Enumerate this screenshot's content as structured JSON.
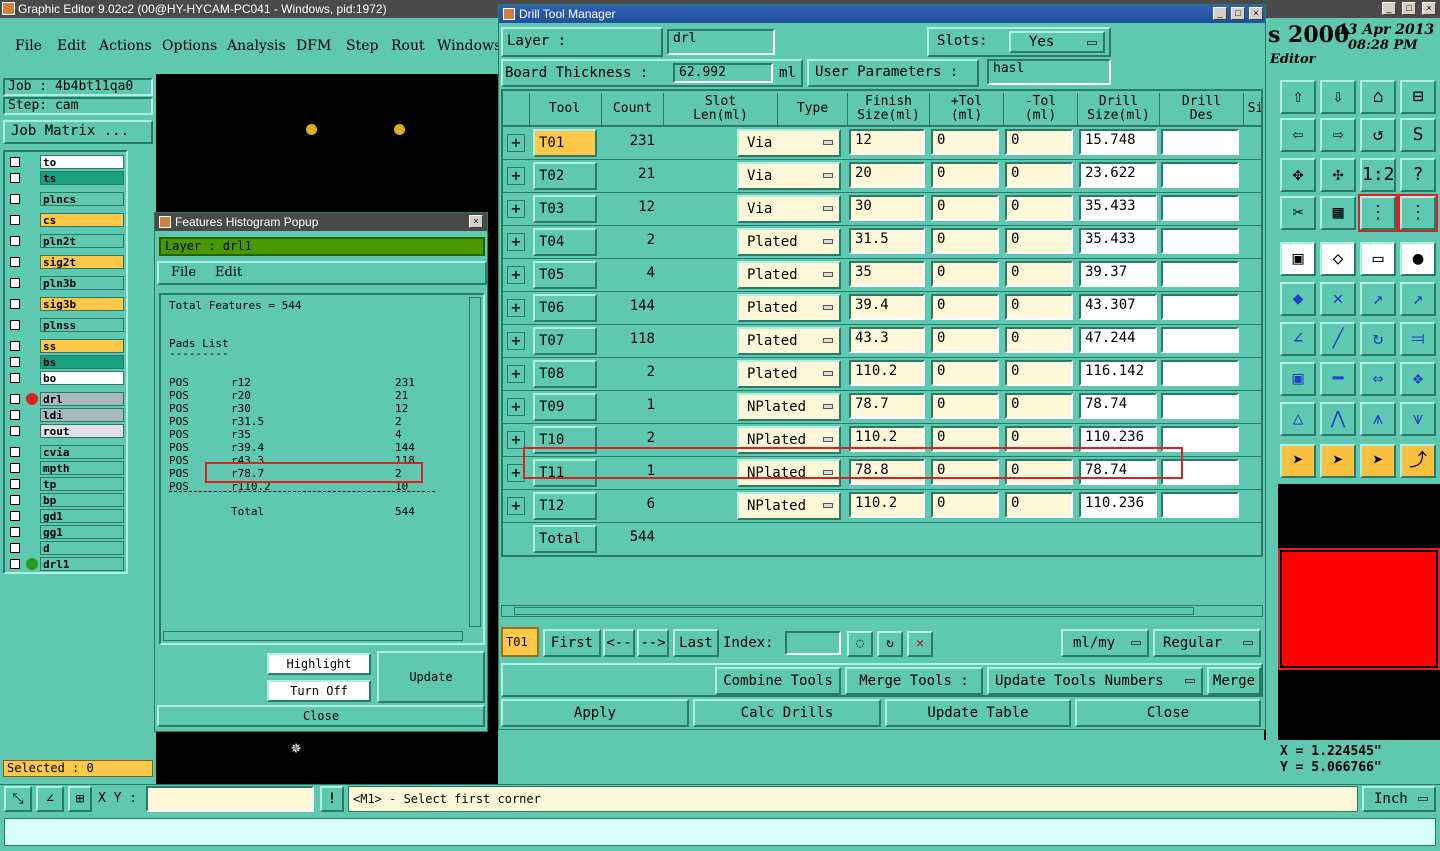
{
  "main_window": {
    "title": "Graphic Editor 9.02c2 (00@HY-HYCAM-PC041 - Windows, pid:1972)",
    "menu": [
      "File",
      "Edit",
      "Actions",
      "Options",
      "Analysis",
      "DFM",
      "Step",
      "Rout",
      "Windows"
    ],
    "job": "Job : 4b4bt11qa0",
    "step": "Step: cam",
    "job_matrix_button": "Job Matrix ...",
    "layers": [
      {
        "name": "to",
        "color": "#ffffff"
      },
      {
        "name": "ts",
        "color": "#1aa080"
      },
      {
        "name": "plncs",
        "color": "#5fc8b0"
      },
      {
        "name": "cs",
        "color": "#ffc848"
      },
      {
        "name": "pln2t",
        "color": "#5fc8b0"
      },
      {
        "name": "sig2t",
        "color": "#ffc848"
      },
      {
        "name": "pln3b",
        "color": "#5fc8b0"
      },
      {
        "name": "sig3b",
        "color": "#ffc848"
      },
      {
        "name": "plnss",
        "color": "#5fc8b0"
      },
      {
        "name": "ss",
        "color": "#ffc848"
      },
      {
        "name": "bs",
        "color": "#1aa080"
      },
      {
        "name": "bo",
        "color": "#ffffff"
      },
      {
        "name": "drl",
        "color": "#a8b8c0"
      },
      {
        "name": "ldi",
        "color": "#a8b8c0"
      },
      {
        "name": "rout",
        "color": "#e0e0e0"
      },
      {
        "name": "cvia",
        "color": "#5fc8b0"
      },
      {
        "name": "mpth",
        "color": "#5fc8b0"
      },
      {
        "name": "tp",
        "color": "#5fc8b0"
      },
      {
        "name": "bp",
        "color": "#5fc8b0"
      },
      {
        "name": "gd1",
        "color": "#5fc8b0"
      },
      {
        "name": "gg1",
        "color": "#5fc8b0"
      },
      {
        "name": "d",
        "color": "#5fc8b0"
      },
      {
        "name": "drl1",
        "color": "#5fc8b0"
      }
    ],
    "selected": "Selected : 0",
    "xy_label": "X Y :",
    "status_msg": "<M1> - Select first corner",
    "units": "Inch",
    "coord_x": "X = 1.224545\"",
    "coord_y": "Y = 5.066766\"",
    "right_header": {
      "app": "s 2000",
      "date": "13 Apr 2013",
      "time": "08:28 PM",
      "mode": "Editor"
    }
  },
  "histogram_popup": {
    "title": "Features Histogram Popup",
    "layer": "Layer :  drl1",
    "menu": [
      "File",
      "Edit"
    ],
    "total_features": "Total Features = 544",
    "pads_title": "Pads List",
    "pads_underline": "---------",
    "rows": [
      {
        "pos": "POS",
        "sym": "r12",
        "count": "231"
      },
      {
        "pos": "POS",
        "sym": "r20",
        "count": "21"
      },
      {
        "pos": "POS",
        "sym": "r30",
        "count": "12"
      },
      {
        "pos": "POS",
        "sym": "r31.5",
        "count": "2"
      },
      {
        "pos": "POS",
        "sym": "r35",
        "count": "4"
      },
      {
        "pos": "POS",
        "sym": "r39.4",
        "count": "144"
      },
      {
        "pos": "POS",
        "sym": "r43.3",
        "count": "118"
      },
      {
        "pos": "POS",
        "sym": "r78.7",
        "count": "2"
      },
      {
        "pos": "POS",
        "sym": "r110.2",
        "count": "10"
      }
    ],
    "total_label": "Total",
    "total_value": "544",
    "buttons": {
      "highlight": "Highlight",
      "turn_off": "Turn Off",
      "update": "Update",
      "close": "Close"
    }
  },
  "drill_tool_manager": {
    "title": "Drill Tool Manager",
    "layer_label": "Layer          :",
    "layer_value": "drl",
    "slots_label": "Slots:",
    "slots_value": "Yes",
    "board_thickness_label": "Board Thickness :",
    "board_thickness_value": "62.992",
    "board_thickness_unit": "ml",
    "user_params_label": "User Parameters :",
    "user_params_value": "hasl",
    "columns": [
      "Tool",
      "Count",
      "Slot\nLen(ml)",
      "Type",
      "Finish\nSize(ml)",
      "+Tol\n(ml)",
      "-Tol\n(ml)",
      "Drill\nSize(ml)",
      "Drill\nDes",
      "Si"
    ],
    "tools": [
      {
        "tool": "T01",
        "count": "231",
        "type": "Via",
        "finish": "12",
        "ptol": "0",
        "mtol": "0",
        "drill": "15.748"
      },
      {
        "tool": "T02",
        "count": "21",
        "type": "Via",
        "finish": "20",
        "ptol": "0",
        "mtol": "0",
        "drill": "23.622"
      },
      {
        "tool": "T03",
        "count": "12",
        "type": "Via",
        "finish": "30",
        "ptol": "0",
        "mtol": "0",
        "drill": "35.433"
      },
      {
        "tool": "T04",
        "count": "2",
        "type": "Plated",
        "finish": "31.5",
        "ptol": "0",
        "mtol": "0",
        "drill": "35.433"
      },
      {
        "tool": "T05",
        "count": "4",
        "type": "Plated",
        "finish": "35",
        "ptol": "0",
        "mtol": "0",
        "drill": "39.37"
      },
      {
        "tool": "T06",
        "count": "144",
        "type": "Plated",
        "finish": "39.4",
        "ptol": "0",
        "mtol": "0",
        "drill": "43.307"
      },
      {
        "tool": "T07",
        "count": "118",
        "type": "Plated",
        "finish": "43.3",
        "ptol": "0",
        "mtol": "0",
        "drill": "47.244"
      },
      {
        "tool": "T08",
        "count": "2",
        "type": "Plated",
        "finish": "110.2",
        "ptol": "0",
        "mtol": "0",
        "drill": "116.142"
      },
      {
        "tool": "T09",
        "count": "1",
        "type": "NPlated",
        "finish": "78.7",
        "ptol": "0",
        "mtol": "0",
        "drill": "78.74"
      },
      {
        "tool": "T10",
        "count": "2",
        "type": "NPlated",
        "finish": "110.2",
        "ptol": "0",
        "mtol": "0",
        "drill": "110.236"
      },
      {
        "tool": "T11",
        "count": "1",
        "type": "NPlated",
        "finish": "78.8",
        "ptol": "0",
        "mtol": "0",
        "drill": "78.74"
      },
      {
        "tool": "T12",
        "count": "6",
        "type": "NPlated",
        "finish": "110.2",
        "ptol": "0",
        "mtol": "0",
        "drill": "110.236"
      }
    ],
    "total_label": "Total",
    "total_count": "544",
    "nav": {
      "current": "T01",
      "first": "First",
      "prev": "<--",
      "next": "-->",
      "last": "Last",
      "index_label": "Index:",
      "units": "ml/my",
      "mode": "Regular"
    },
    "actions1": {
      "combine": "Combine Tools",
      "merge_label": "Merge Tools :",
      "update_numbers": "Update Tools Numbers",
      "merge": "Merge"
    },
    "actions2": {
      "apply": "Apply",
      "calc": "Calc Drills",
      "update_table": "Update Table",
      "close": "Close"
    }
  },
  "colors": {
    "panel": "#5fc8b0",
    "highlight": "#ffc848",
    "canvas": "#000000",
    "annotation": "#e02020"
  }
}
